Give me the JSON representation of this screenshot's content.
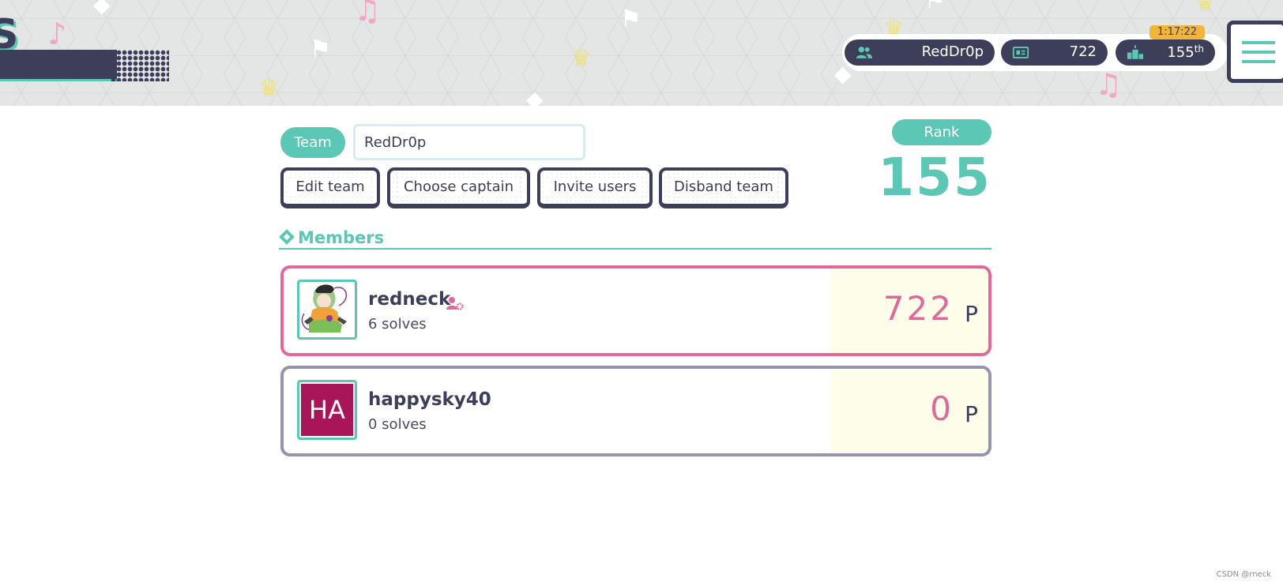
{
  "header": {
    "logo_letter": "S",
    "user": {
      "icon": "team-icon",
      "value": "RedDr0p"
    },
    "score": {
      "icon": "score-card-icon",
      "value": "722"
    },
    "rank": {
      "icon": "podium-icon",
      "value": "155",
      "suffix": "th"
    },
    "timer": "1:17:22",
    "menu_icon": "hamburger-menu-icon"
  },
  "team": {
    "label": "Team",
    "name_value": "RedDr0p",
    "actions": [
      "Edit team",
      "Choose captain",
      "Invite users",
      "Disband team"
    ]
  },
  "rank": {
    "label": "Rank",
    "value": "155"
  },
  "members": {
    "title": "Members",
    "items": [
      {
        "name": "redneck",
        "solves": "6 solves",
        "score": "722",
        "unit": "P",
        "is_captain": true,
        "avatar": "anime-character-avatar"
      },
      {
        "name": "happysky40",
        "solves": "0 solves",
        "score": "0",
        "unit": "P",
        "is_captain": false,
        "avatar_initials": "HA"
      }
    ]
  },
  "watermark": "CSDN @rneck",
  "colors": {
    "teal": "#5bc7b4",
    "navy": "#3d3e5a",
    "pink": "#e0689a",
    "captain_border": "#e0689a",
    "member_border": "#9593ad",
    "score_bg": "#fdfdea",
    "timer_bg": "#f2b53c",
    "avatar_bg": "#a81559"
  }
}
